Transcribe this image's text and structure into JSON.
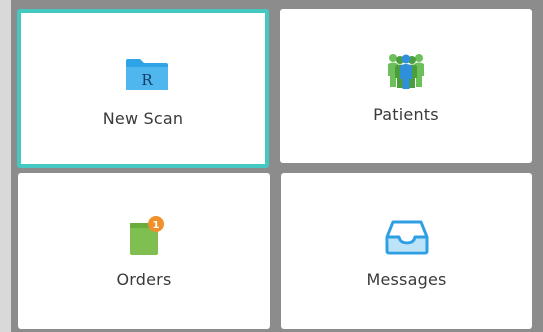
{
  "tiles": {
    "new_scan": {
      "label": "New Scan",
      "icon": "rx-folder-icon",
      "icon_text": "R",
      "selected": true
    },
    "patients": {
      "label": "Patients",
      "icon": "people-group-icon"
    },
    "orders": {
      "label": "Orders",
      "icon": "clipboard-icon",
      "badge_count": "1"
    },
    "messages": {
      "label": "Messages",
      "icon": "inbox-tray-icon"
    }
  },
  "colors": {
    "selected_border": "#45c8c1",
    "folder_blue": "#2ea3e6",
    "people_green": "#5aa84a",
    "people_blue": "#2f8fd8",
    "orders_green": "#7fbf4f",
    "badge_orange": "#f0902a",
    "inbox_blue": "#2e9fe3"
  }
}
